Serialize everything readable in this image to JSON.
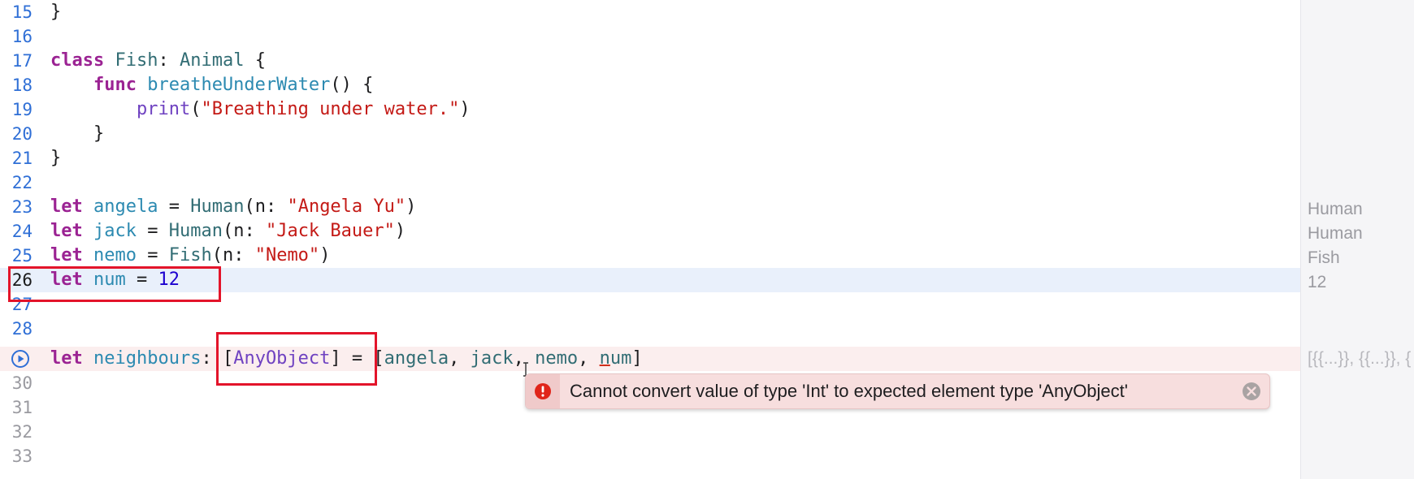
{
  "editor": {
    "lines": [
      {
        "n": "15",
        "text": "}"
      },
      {
        "n": "16",
        "text": ""
      },
      {
        "n": "17",
        "text": "class Fish: Animal {"
      },
      {
        "n": "18",
        "text": "    func breatheUnderWater() {"
      },
      {
        "n": "19",
        "text": "        print(\"Breathing under water.\")"
      },
      {
        "n": "20",
        "text": "    }"
      },
      {
        "n": "21",
        "text": "}"
      },
      {
        "n": "22",
        "text": ""
      },
      {
        "n": "23",
        "text": "let angela = Human(n: \"Angela Yu\")"
      },
      {
        "n": "24",
        "text": "let jack = Human(n: \"Jack Bauer\")"
      },
      {
        "n": "25",
        "text": "let nemo = Fish(n: \"Nemo\")"
      },
      {
        "n": "26",
        "text": "let num = 12"
      },
      {
        "n": "27",
        "text": ""
      },
      {
        "n": "28",
        "text": ""
      },
      {
        "n": "",
        "text": "let neighbours: [AnyObject] = [angela, jack, nemo, num]"
      },
      {
        "n": "30",
        "text": ""
      },
      {
        "n": "31",
        "text": ""
      },
      {
        "n": "32",
        "text": ""
      },
      {
        "n": "33",
        "text": ""
      }
    ],
    "current_line": "26",
    "error_line_icon": "run-icon"
  },
  "results": {
    "r23": "Human",
    "r24": "Human",
    "r25": "Fish",
    "r26": "12",
    "r29": "[{{...}}, {{...}}, {"
  },
  "error": {
    "message": "Cannot convert value of type 'Int' to expected element type 'AnyObject'",
    "icon": "error-icon",
    "close_icon": "close-icon"
  },
  "colors": {
    "highlight_box": "#e3142a",
    "current_line_bg": "#e9f0fb",
    "error_line_bg": "#fbeeee"
  }
}
